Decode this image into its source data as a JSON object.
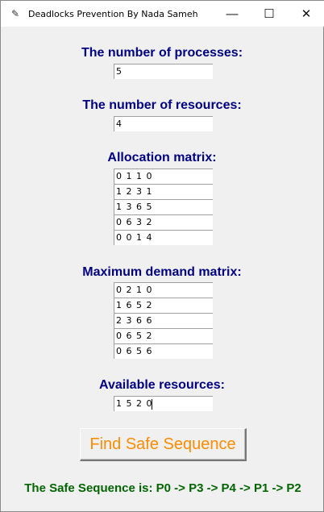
{
  "window": {
    "title": "Deadlocks Prevention By Nada Sameh",
    "minimize": "—",
    "maximize": "☐",
    "close": "✕"
  },
  "processes": {
    "label": "The number of processes:",
    "value": "5"
  },
  "resources": {
    "label": "The number of resources:",
    "value": "4"
  },
  "allocation": {
    "label": "Allocation matrix:",
    "rows": [
      "0 1 1 0",
      "1 2 3 1",
      "1 3 6 5",
      "0 6 3 2",
      "0 0 1 4"
    ]
  },
  "maximum": {
    "label": "Maximum demand matrix:",
    "rows": [
      "0 2 1 0",
      "1 6 5 2",
      "2 3 6 6",
      "0 6 5 2",
      "0 6 5 6"
    ]
  },
  "available": {
    "label": "Available resources:",
    "value": "1 5 2 0"
  },
  "button": {
    "label": "Find Safe Sequence"
  },
  "result": {
    "text": "The Safe Sequence is: P0 -> P3 -> P4 -> P1 -> P2"
  }
}
